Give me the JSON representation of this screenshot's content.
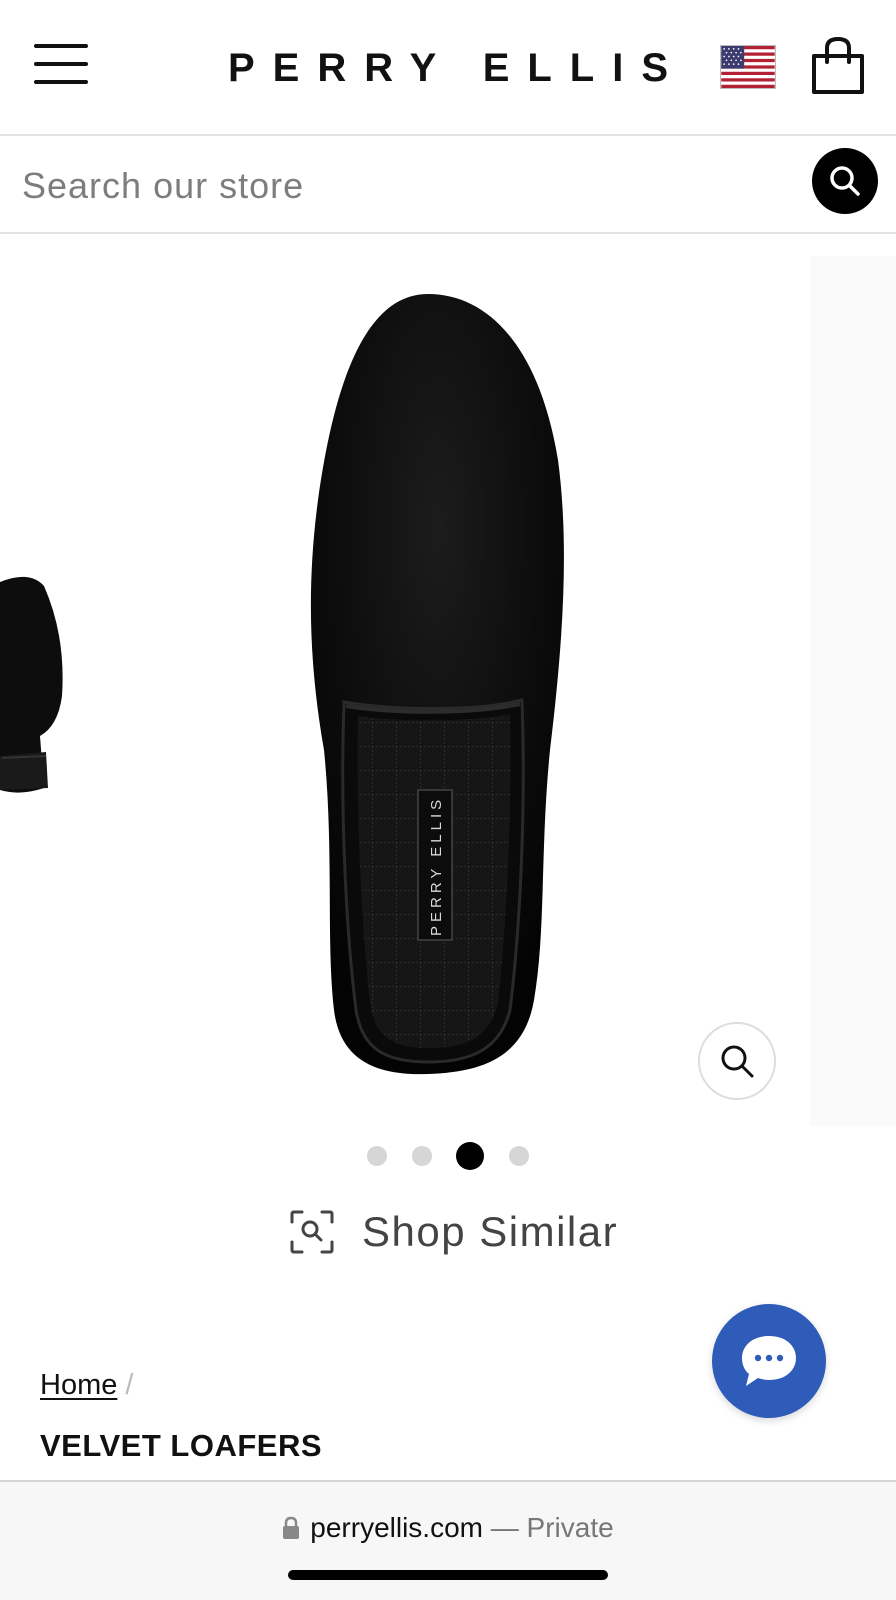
{
  "header": {
    "logo": "PERRY ELLIS",
    "menu_icon": "hamburger-menu-icon",
    "flag_icon": "us-flag-icon",
    "cart_icon": "shopping-bag-icon"
  },
  "search": {
    "placeholder": "Search our store",
    "icon": "search-icon"
  },
  "gallery": {
    "label_on_insole": "PERRY ELLIS",
    "dots_count": 4,
    "active_dot": 3,
    "zoom_icon": "zoom-magnifier-icon"
  },
  "shop_similar": {
    "label": "Shop Similar",
    "icon": "visual-search-icon"
  },
  "breadcrumb": {
    "home": "Home",
    "separator": "/"
  },
  "product": {
    "title": "VELVET LOAFERS"
  },
  "chat": {
    "icon": "chat-bubble-icon",
    "color": "#2e5cb8"
  },
  "browser": {
    "domain": "perryellis.com",
    "suffix": "— Private",
    "lock_icon": "lock-icon"
  }
}
